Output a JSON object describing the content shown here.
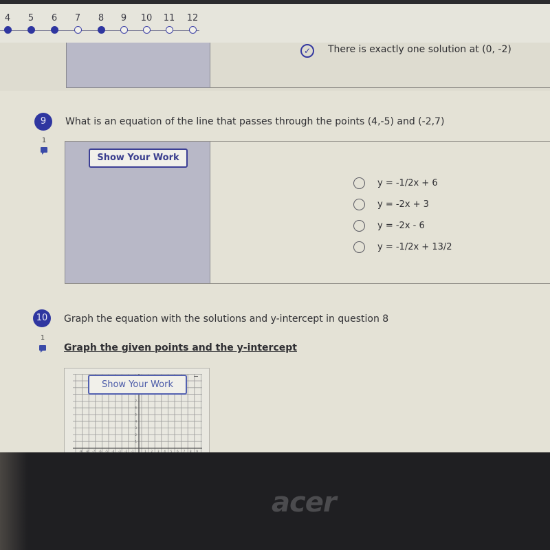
{
  "progress": {
    "steps": [
      {
        "label": "4",
        "answered": true
      },
      {
        "label": "5",
        "answered": true
      },
      {
        "label": "6",
        "answered": true
      },
      {
        "label": "7",
        "answered": false
      },
      {
        "label": "8",
        "answered": true
      },
      {
        "label": "9",
        "answered": false
      },
      {
        "label": "10",
        "answered": false
      },
      {
        "label": "11",
        "answered": false
      },
      {
        "label": "12",
        "answered": false
      }
    ]
  },
  "question8": {
    "selected_answer": "There is exactly one solution at (0, -2)",
    "check_icon": "check-circle-icon"
  },
  "question9": {
    "number": "9",
    "points": "1",
    "text": "What is an equation of the line that passes through the points (4,-5) and (-2,7)",
    "show_work_label": "Show Your Work",
    "options": [
      {
        "label": "y = -1/2x + 6",
        "selected": false
      },
      {
        "label": "y = -2x + 3",
        "selected": false
      },
      {
        "label": "y = -2x - 6",
        "selected": false
      },
      {
        "label": "y = -1/2x + 13/2",
        "selected": false
      }
    ]
  },
  "question10": {
    "number": "10",
    "points": "1",
    "text": "Graph the equation with the solutions and y-intercept in question 8",
    "subtitle": "Graph the given points and the y-intercept",
    "show_work_label": "Show Your Work",
    "graph": {
      "x_ticks": [
        "-9",
        "-8",
        "-7",
        "-6",
        "-5",
        "-4",
        "-3",
        "-2",
        "-1",
        "1",
        "2",
        "3",
        "4",
        "5",
        "6",
        "7",
        "8",
        "9"
      ],
      "y_ticks": [
        "1",
        "2",
        "3",
        "4",
        "5",
        "6",
        "7"
      ]
    }
  },
  "device": {
    "brand": "acer"
  }
}
